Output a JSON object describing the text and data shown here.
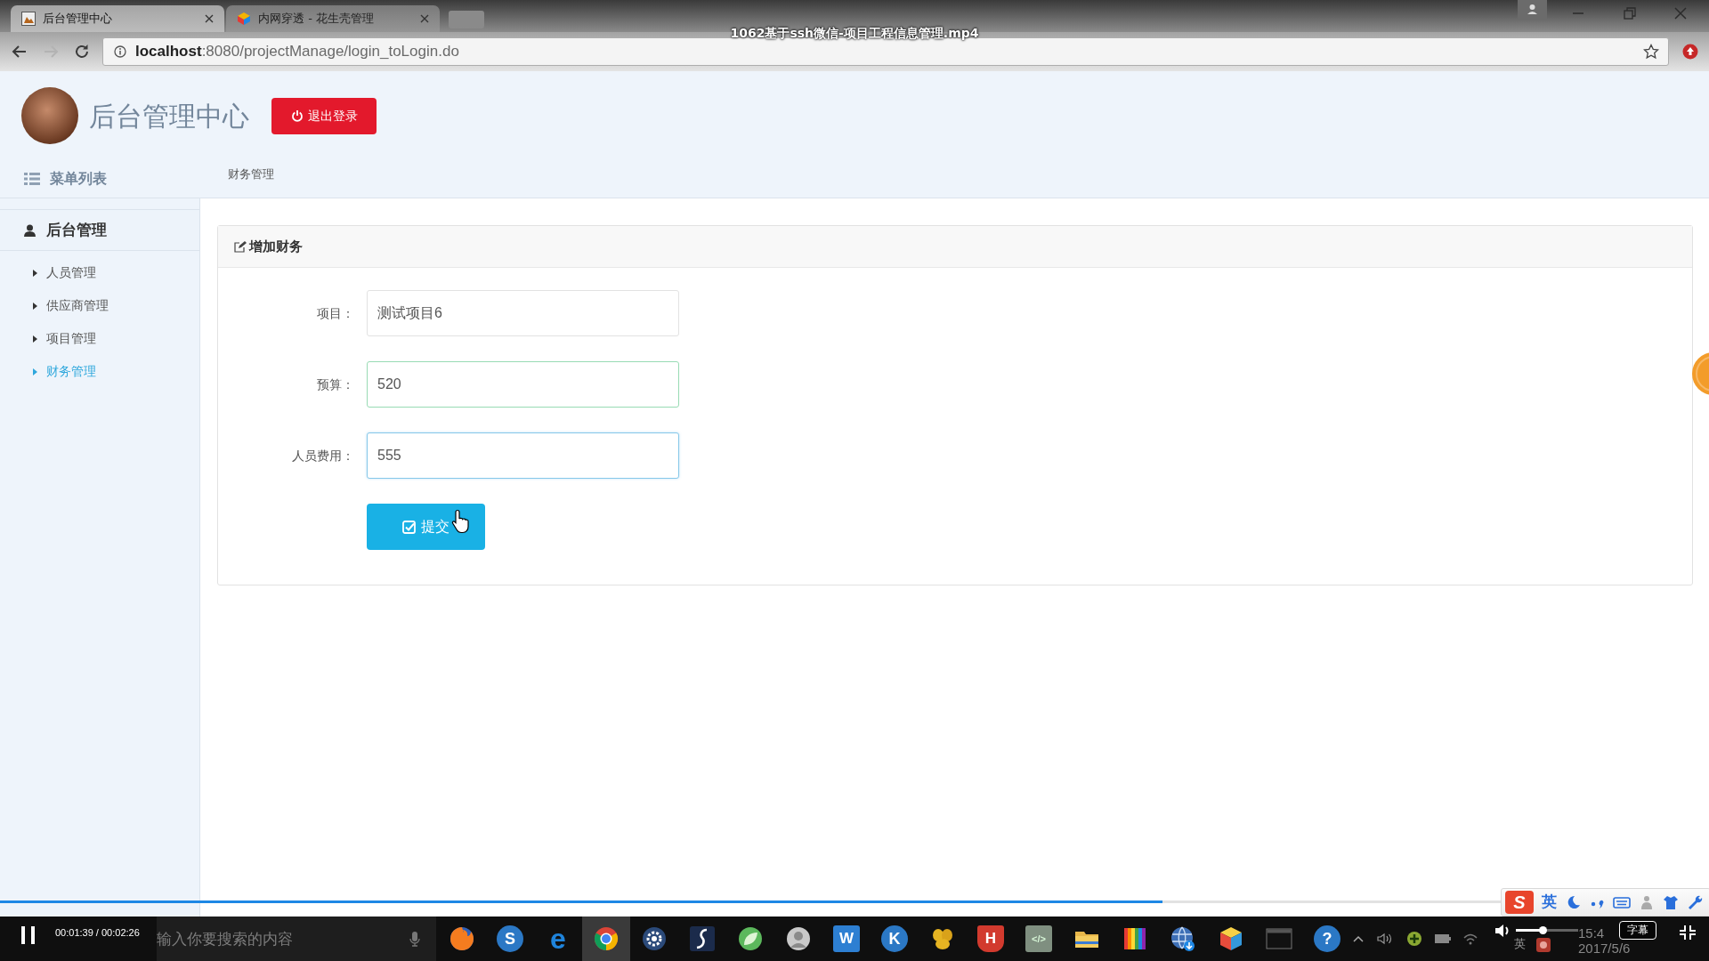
{
  "video_player": {
    "title": "1062基于ssh微信-项目工程信息管理.mp4",
    "playing": true,
    "time": "00:01:39 / 00:02:26",
    "progress": {
      "level": 0.68
    },
    "volume": {
      "level": 0.43
    },
    "subtitle_button": "字幕"
  },
  "browser": {
    "tabs": [
      {
        "title": "后台管理中心",
        "kind": "page",
        "selected": true
      },
      {
        "title": "内网穿透 - 花生壳管理",
        "kind": "cube",
        "selected": false
      }
    ],
    "nav_buttons": [
      {
        "kind": "back",
        "disabled": false
      },
      {
        "kind": "forward",
        "disabled": true
      },
      {
        "kind": "reload",
        "disabled": false
      }
    ],
    "url": "**localhost**:8080/projectManage/login_toLogin.do"
  },
  "page": {
    "title": "后台管理中心",
    "logout_button": "退出登录",
    "menu_label": "菜单列表",
    "breadcrumb": "财务管理",
    "sidebar": {
      "section": "后台管理",
      "items": [
        {
          "label": "人员管理",
          "selected": false
        },
        {
          "label": "供应商管理",
          "selected": false
        },
        {
          "label": "项目管理",
          "selected": false
        },
        {
          "label": "财务管理",
          "selected": true
        }
      ]
    },
    "form": {
      "title": "增加财务",
      "fields": [
        {
          "label": "项目：",
          "value": "测试项目6",
          "valid": false,
          "focused": false
        },
        {
          "label": "预算：",
          "value": "520",
          "valid": true,
          "focused": false
        },
        {
          "label": "人员费用：",
          "value": "555",
          "valid": false,
          "focused": true
        }
      ],
      "submit_button": "提交"
    }
  },
  "ime_toolbar": {
    "logo": "S",
    "mode": "英"
  },
  "taskbar": {
    "search": {
      "placeholder": "输入你要搜索的内容"
    },
    "apps": [
      {
        "kind": "swirl",
        "selected": false
      },
      {
        "kind": "disc",
        "glyph": "S",
        "selected": false
      },
      {
        "kind": "plain",
        "glyph": "e",
        "selected": false
      },
      {
        "kind": "ring",
        "selected": true
      },
      {
        "kind": "gear",
        "selected": false
      },
      {
        "kind": "script",
        "selected": false
      },
      {
        "kind": "leaf",
        "selected": false
      },
      {
        "kind": "avatar",
        "selected": false
      },
      {
        "kind": "tile",
        "glyph": "W",
        "selected": false
      },
      {
        "kind": "disc",
        "glyph": "K",
        "selected": false
      },
      {
        "kind": "paw",
        "selected": false
      },
      {
        "kind": "shield",
        "glyph": "H",
        "selected": false
      },
      {
        "kind": "code",
        "glyph": "</>",
        "selected": false
      },
      {
        "kind": "folder",
        "selected": false
      },
      {
        "kind": "bars",
        "selected": false
      },
      {
        "kind": "globe",
        "selected": false
      },
      {
        "kind": "cube",
        "selected": false
      },
      {
        "kind": "terminal",
        "selected": false
      },
      {
        "kind": "disc",
        "glyph": "?",
        "selected": false
      }
    ],
    "tray": {
      "ime": "英",
      "time": "15:4",
      "date": "2017/5/6"
    }
  }
}
